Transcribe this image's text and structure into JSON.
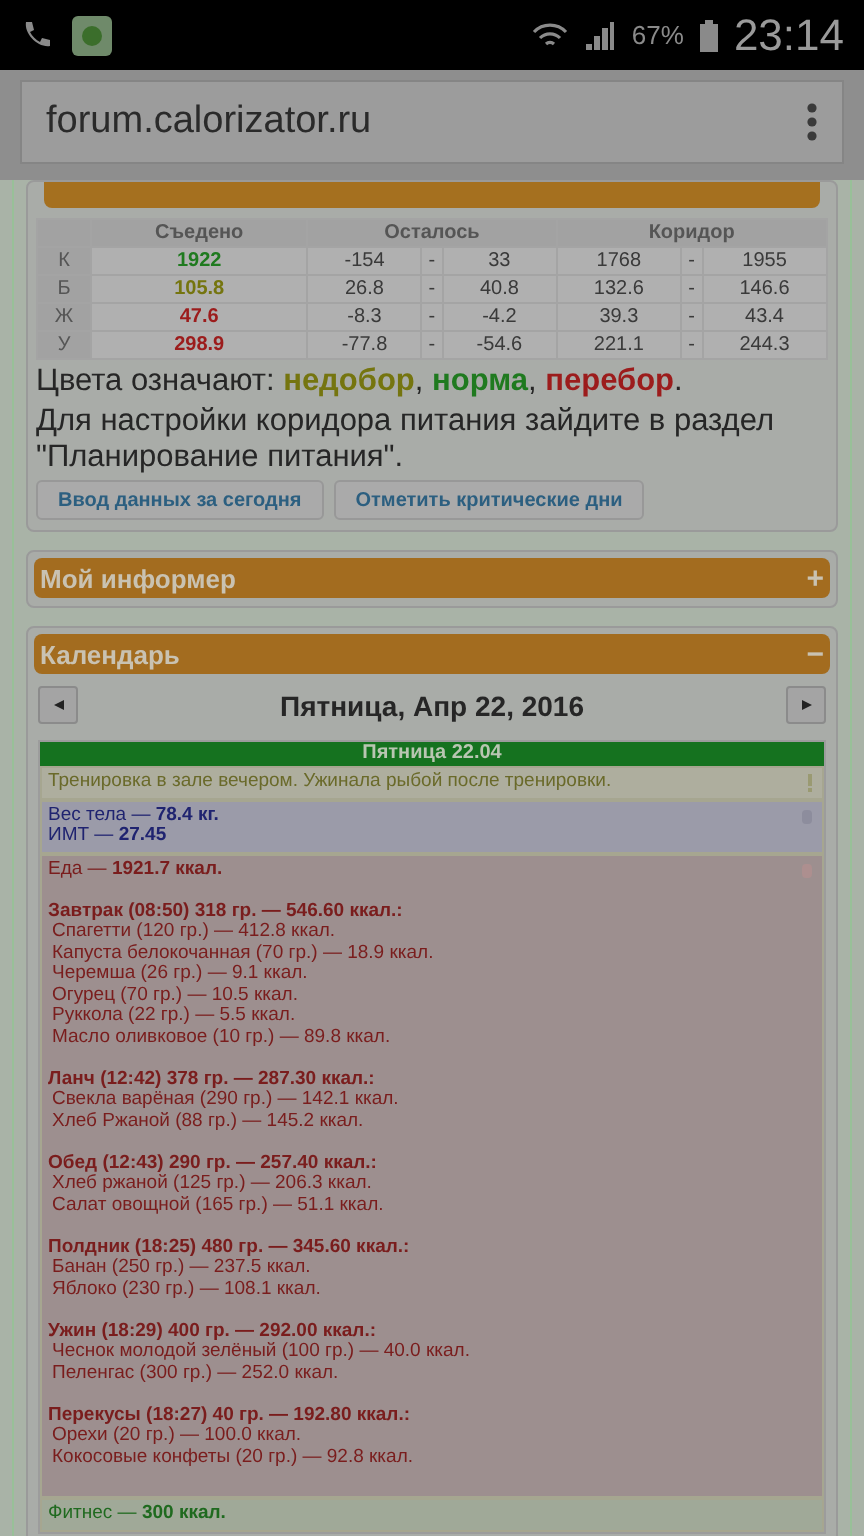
{
  "status_bar": {
    "battery": "67%",
    "time": "23:14"
  },
  "address_bar": {
    "url": "forum.calorizator.ru"
  },
  "nutrition_table": {
    "columns": [
      "Съедено",
      "Осталось",
      "Коридор"
    ],
    "rows": [
      {
        "label": "К",
        "eaten": "1922",
        "color": "#1f7a1f",
        "remaining": [
          "-154",
          "-",
          "33"
        ],
        "corridor": [
          "1768",
          "-",
          "1955"
        ]
      },
      {
        "label": "Б",
        "eaten": "105.8",
        "color": "#75750f",
        "remaining": [
          "26.8",
          "-",
          "40.8"
        ],
        "corridor": [
          "132.6",
          "-",
          "146.6"
        ]
      },
      {
        "label": "Ж",
        "eaten": "47.6",
        "color": "#9c1c1c",
        "remaining": [
          "-8.3",
          "-",
          "-4.2"
        ],
        "corridor": [
          "39.3",
          "-",
          "43.4"
        ]
      },
      {
        "label": "У",
        "eaten": "298.9",
        "color": "#9c1c1c",
        "remaining": [
          "-77.8",
          "-",
          "-54.6"
        ],
        "corridor": [
          "221.1",
          "-",
          "244.3"
        ]
      }
    ]
  },
  "legend": [
    {
      "text": "Цвета означают: "
    },
    {
      "text": "недобор",
      "color": "#75750f"
    },
    {
      "text": ", "
    },
    {
      "text": "норма",
      "color": "#1f7a1f"
    },
    {
      "text": ", "
    },
    {
      "text": "перебор",
      "color": "#9c1c1c"
    },
    {
      "text": "."
    }
  ],
  "note": "Для настройки коридора питания зайдите в раздел \"Планирование питания\".",
  "buttons": [
    "Ввод данных за сегодня",
    "Отметить критические дни"
  ],
  "panels": [
    {
      "title": "Мой информер",
      "toggle": "+",
      "expanded": false
    },
    {
      "title": "Календарь",
      "toggle": "−",
      "expanded": true
    }
  ],
  "calendar": {
    "date": "Пятница, Апр 22, 2016",
    "day_header": "Пятница 22.04",
    "comment": "Тренировка в зале вечером. Ужинала рыбой после тренировки.",
    "body": [
      "Вес тела — **78.4 кг.**",
      "ИМТ — **27.45**"
    ],
    "food_total": "Еда — **1921.7 ккал.**",
    "meals": [
      {
        "title": "Завтрак (08:50) 318 гр. — 546.60 ккал.:",
        "items": [
          "Спагетти (120 гр.) — 412.8 ккал.",
          "Капуста белокочанная (70 гр.) — 18.9 ккал.",
          "Черемша (26 гр.) — 9.1 ккал.",
          "Огурец (70 гр.) — 10.5 ккал.",
          "Руккола (22 гр.) — 5.5 ккал.",
          "Масло оливковое (10 гр.) — 89.8 ккал."
        ]
      },
      {
        "title": "Ланч (12:42) 378 гр. — 287.30 ккал.:",
        "items": [
          "Свекла варёная (290 гр.) — 142.1 ккал.",
          "Хлеб Ржаной (88 гр.) — 145.2 ккал."
        ]
      },
      {
        "title": "Обед (12:43) 290 гр. — 257.40 ккал.:",
        "items": [
          "Хлеб ржаной (125 гр.) — 206.3 ккал.",
          "Салат овощной (165 гр.) — 51.1 ккал."
        ]
      },
      {
        "title": "Полдник (18:25) 480 гр. — 345.60 ккал.:",
        "items": [
          "Банан (250 гр.) — 237.5 ккал.",
          "Яблоко (230 гр.) — 108.1 ккал."
        ]
      },
      {
        "title": "Ужин (18:29) 400 гр. — 292.00 ккал.:",
        "items": [
          "Чеснок молодой зелёный (100 гр.) — 40.0 ккал.",
          "Пеленгас (300 гр.) — 252.0 ккал."
        ]
      },
      {
        "title": "Перекусы (18:27) 40 гр. — 192.80 ккал.:",
        "items": [
          "Орехи (20 гр.) — 100.0 ккал.",
          "Кокосовые конфеты (20 гр.) — 92.8 ккал."
        ]
      }
    ],
    "fitness": "Фитнес — **300 ккал.**"
  }
}
